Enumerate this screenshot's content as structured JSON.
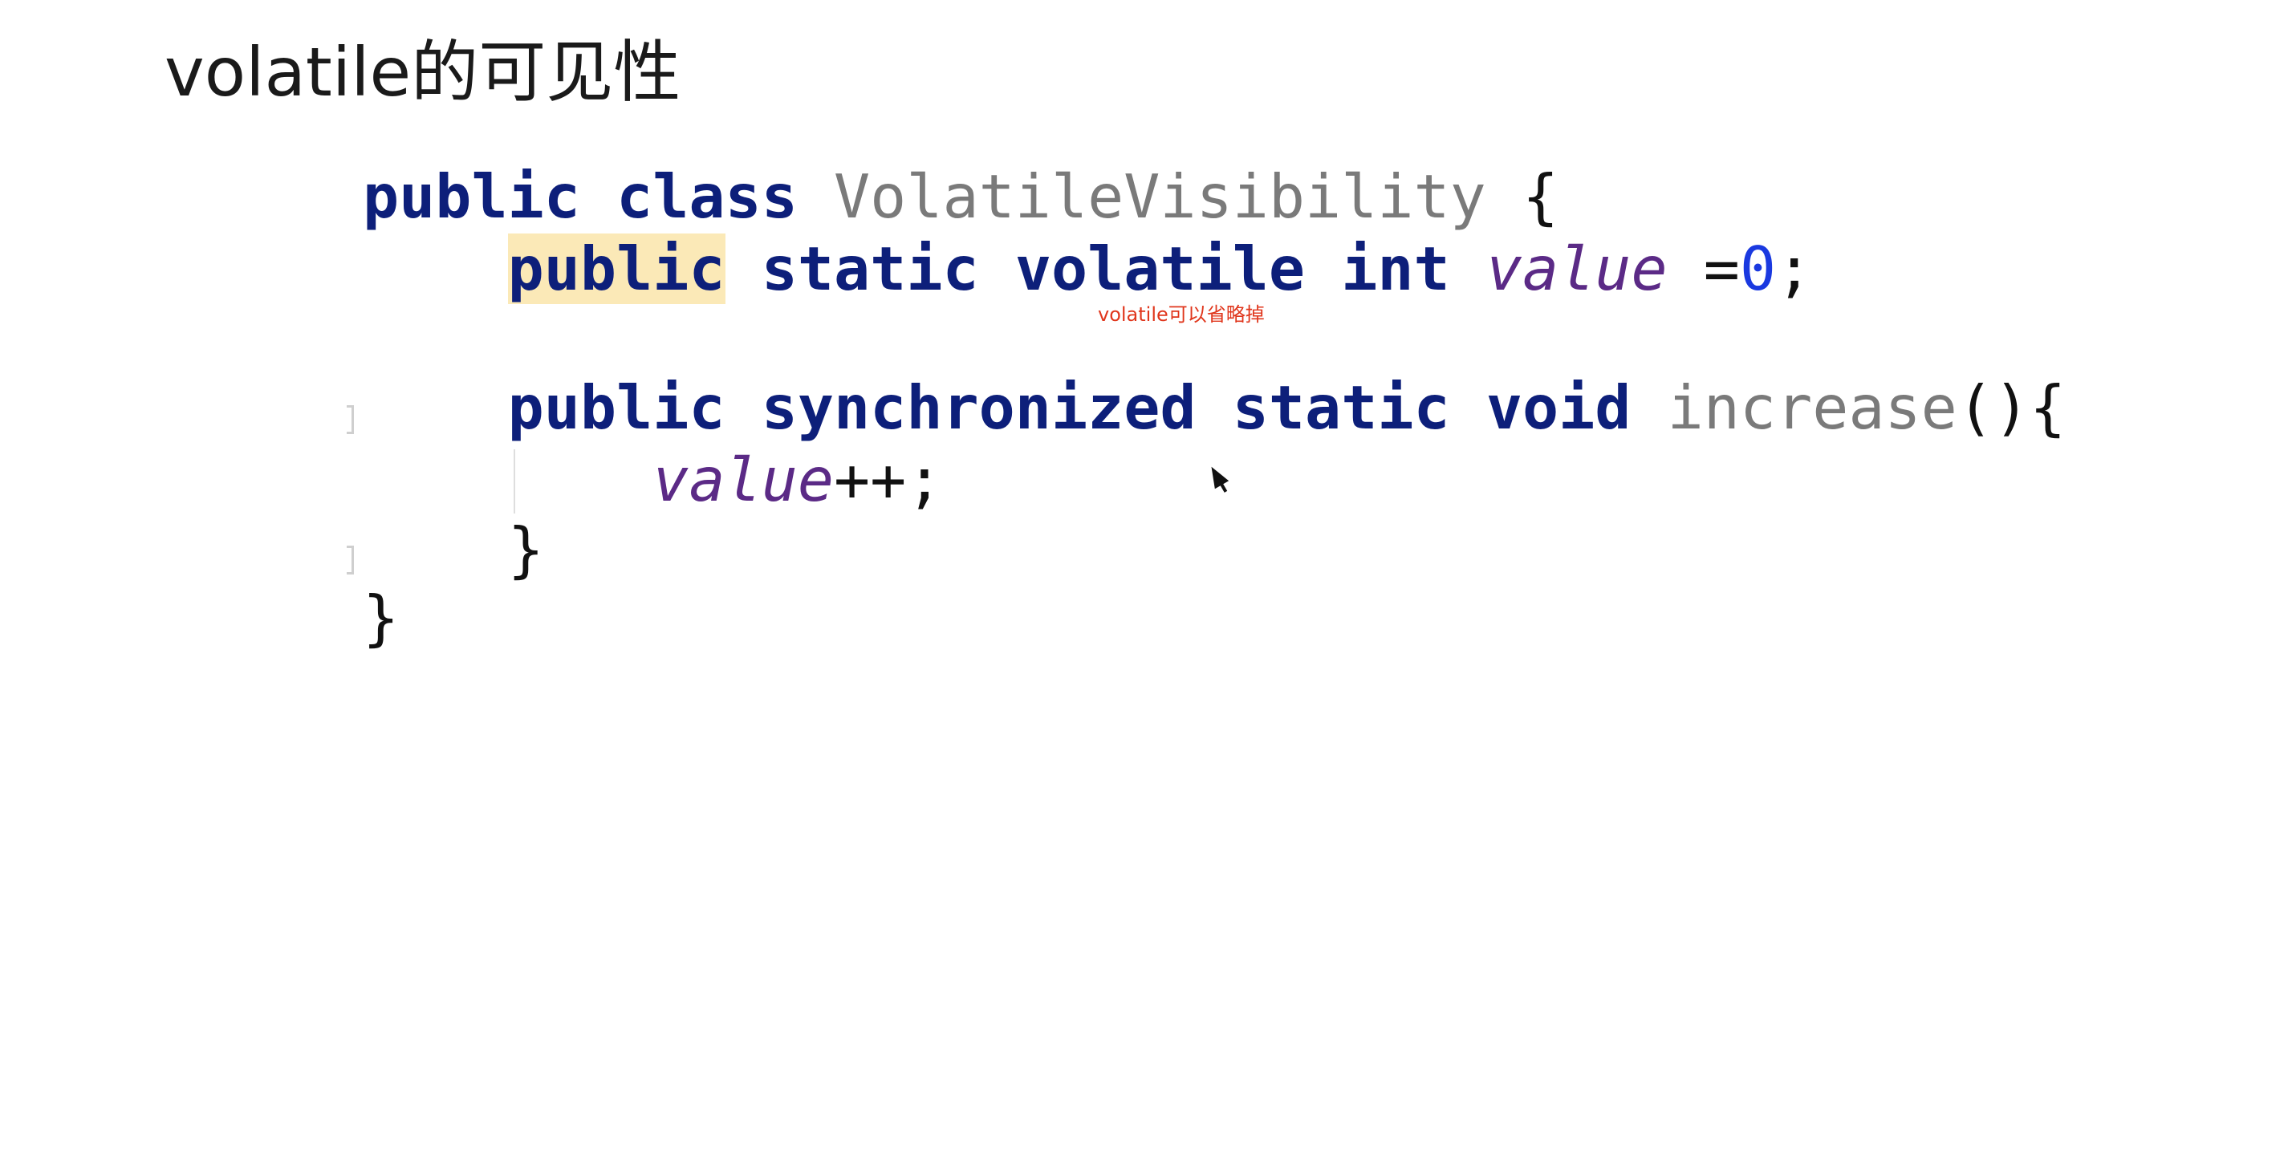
{
  "slide": {
    "title": "volatile的可见性"
  },
  "code": {
    "line1": {
      "kw_public": "public",
      "kw_class": "class",
      "class_name": "VolatileVisibility",
      "brace_open": "{"
    },
    "line2": {
      "indent": "    ",
      "kw_public": "public",
      "kw_static": "static",
      "kw_volatile": "volatile",
      "kw_int": "int",
      "field": "value",
      "assign": "=",
      "number": "0",
      "semicolon": ";"
    },
    "line3": {
      "indent": "    ",
      "kw_public": "public",
      "kw_synchronized": "synchronized",
      "kw_static": "static",
      "kw_void": "void",
      "method": "increase",
      "parens_brace": "(){"
    },
    "line4": {
      "indent": "        ",
      "field": "value",
      "op": "++;"
    },
    "line5": {
      "indent": "    ",
      "brace_close": "}"
    },
    "line6": {
      "brace_close": "}"
    }
  },
  "annotation": {
    "text": "volatile可以省略掉",
    "color": "#e0361c"
  },
  "icons": {
    "cursor": "mouse-pointer-icon",
    "fold_markers": "fold-marker-icon"
  },
  "colors": {
    "keyword": "#0d1f7a",
    "identifier": "#7a7a7a",
    "field": "#5b2a86",
    "number": "#1a39e0",
    "highlight": "#fbe9b7"
  }
}
